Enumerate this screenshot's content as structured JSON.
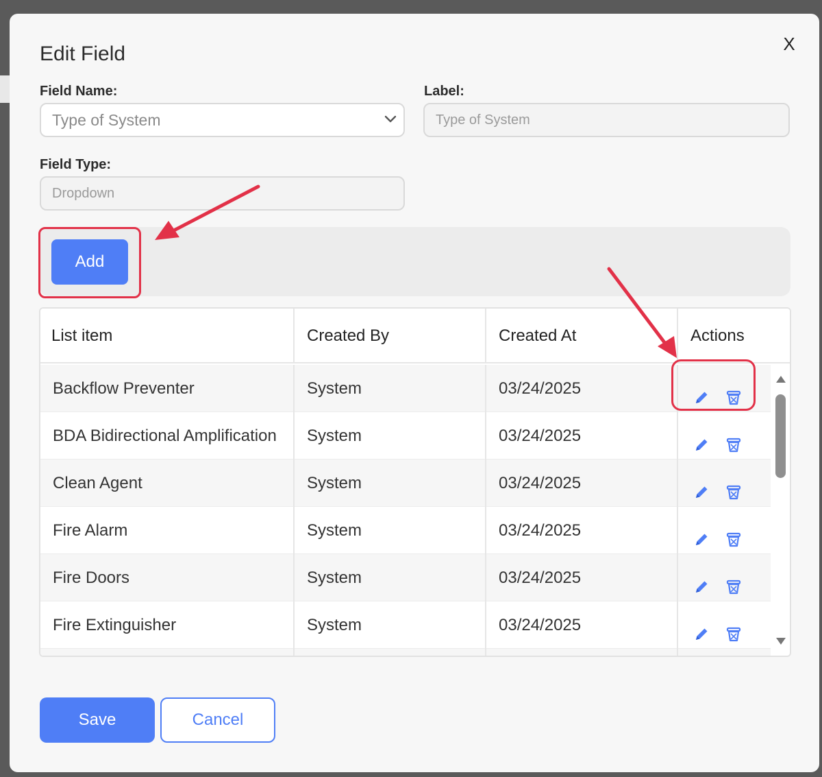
{
  "dialog": {
    "title": "Edit Field",
    "close_label": "X"
  },
  "form": {
    "field_name": {
      "label": "Field Name:",
      "value": "Type of System"
    },
    "label_field": {
      "label": "Label:",
      "value": "Type of System"
    },
    "field_type": {
      "label": "Field Type:",
      "value": "Dropdown"
    }
  },
  "add_button_label": "Add",
  "table": {
    "columns": [
      "List item",
      "Created By",
      "Created At",
      "Actions"
    ],
    "rows": [
      {
        "item": "Backflow Preventer",
        "created_by": "System",
        "created_at": "03/24/2025"
      },
      {
        "item": "BDA Bidirectional Amplification",
        "created_by": "System",
        "created_at": "03/24/2025"
      },
      {
        "item": "Clean Agent",
        "created_by": "System",
        "created_at": "03/24/2025"
      },
      {
        "item": "Fire Alarm",
        "created_by": "System",
        "created_at": "03/24/2025"
      },
      {
        "item": "Fire Doors",
        "created_by": "System",
        "created_at": "03/24/2025"
      },
      {
        "item": "Fire Extinguisher",
        "created_by": "System",
        "created_at": "03/24/2025"
      }
    ]
  },
  "footer": {
    "save_label": "Save",
    "cancel_label": "Cancel"
  },
  "icons": {
    "edit": "pencil-icon",
    "delete": "trash-icon",
    "select": "chevron-down-icon"
  },
  "colors": {
    "primary": "#4f7ef6",
    "annotation": "#e23148"
  }
}
